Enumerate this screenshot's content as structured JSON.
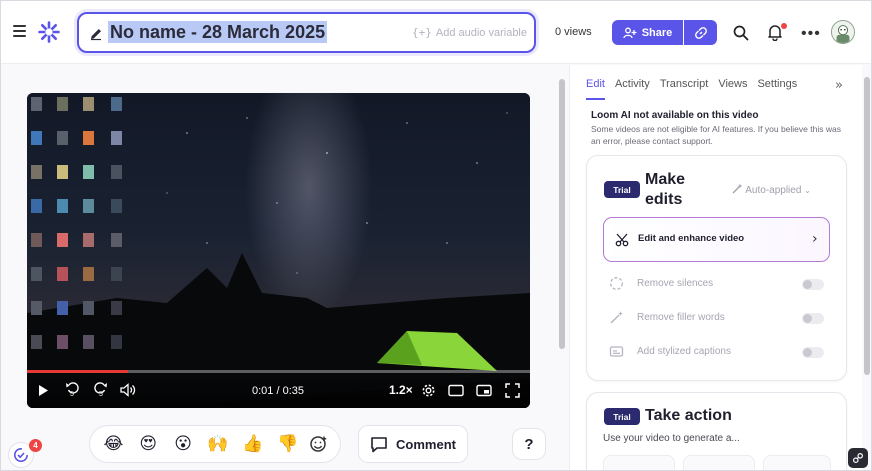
{
  "header": {
    "title": "No name - 28 March 2025",
    "audio_variable": "Add audio variable",
    "views": "0 views",
    "share_label": "Share"
  },
  "video": {
    "time": "0:01 / 0:35",
    "speed": "1.2×",
    "progress_fraction": 0.2,
    "skip_back": "5",
    "skip_forward": "5"
  },
  "reactions": [
    "😂",
    "😍",
    "😮",
    "🙌",
    "👍",
    "👎"
  ],
  "comment_label": "Comment",
  "help_label": "?",
  "onboarding_badge": "4",
  "side_panel": {
    "tabs": [
      {
        "label": "Edit",
        "active": true
      },
      {
        "label": "Activity",
        "active": false
      },
      {
        "label": "Transcript",
        "active": false
      },
      {
        "label": "Views",
        "active": false
      },
      {
        "label": "Settings",
        "active": false
      }
    ],
    "ai_title": "Loom AI not available on this video",
    "ai_desc": "Some videos are not eligible for AI features. If you believe this was an error, please contact support.",
    "make_edits": {
      "badge": "Trial",
      "title_line1": "Make",
      "title_line2": "edits",
      "auto_applied": "Auto-applied",
      "edit_enhance": "Edit and enhance video",
      "features": [
        {
          "label": "Remove silences",
          "icon": "silence-icon"
        },
        {
          "label": "Remove filler words",
          "icon": "magic-wand-icon"
        },
        {
          "label": "Add stylized captions",
          "icon": "captions-icon"
        }
      ]
    },
    "take_action": {
      "badge": "Trial",
      "title": "Take action",
      "desc": "Use your video to generate a..."
    }
  },
  "colors": {
    "accent": "#5b54e8",
    "trial_badge": "#2b2a6e",
    "notification": "#ef4444"
  }
}
